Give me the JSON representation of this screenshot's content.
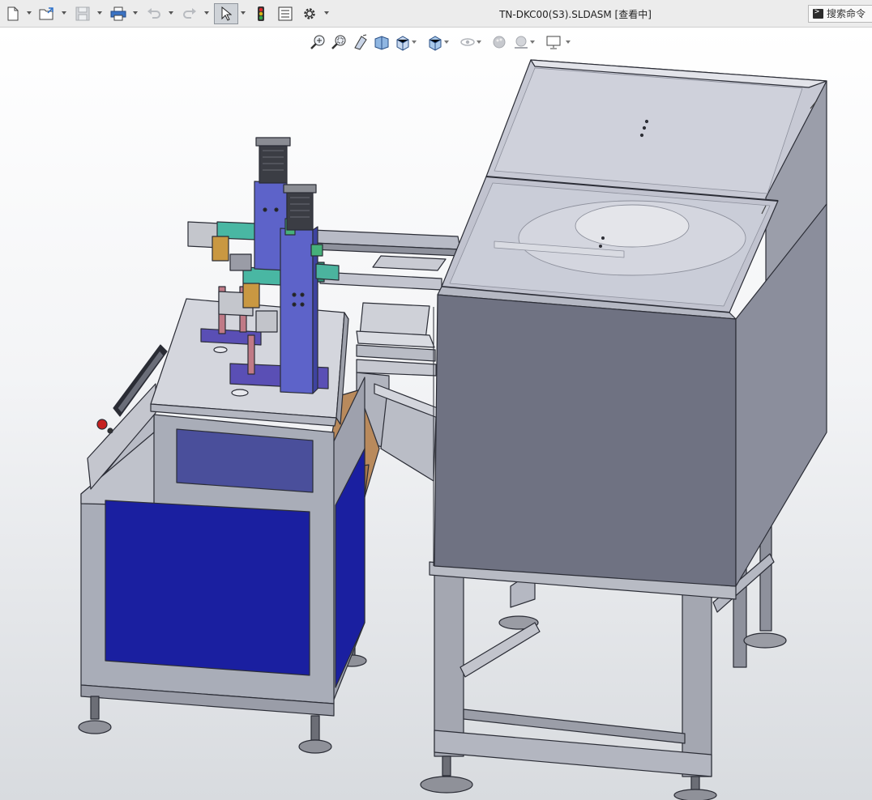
{
  "window": {
    "title": "TN-DKC00(S3).SLDASM [查看中]"
  },
  "toolbar": {
    "items": [
      {
        "icon": "new-document-icon",
        "has_dropdown": true
      },
      {
        "icon": "open-folder-icon",
        "has_dropdown": true
      },
      {
        "icon": "save-icon",
        "has_dropdown": true,
        "disabled": true
      },
      {
        "icon": "print-icon",
        "has_dropdown": true
      },
      {
        "icon": "undo-icon",
        "has_dropdown": true,
        "disabled": true
      },
      {
        "icon": "redo-icon",
        "has_dropdown": true,
        "disabled": true
      },
      {
        "icon": "select-pointer-icon",
        "has_dropdown": true,
        "active": true
      },
      {
        "icon": "traffic-light-icon",
        "has_dropdown": false
      },
      {
        "icon": "file-properties-icon",
        "has_dropdown": false
      },
      {
        "icon": "options-gear-icon",
        "has_dropdown": true
      }
    ]
  },
  "search": {
    "placeholder": "搜索命令"
  },
  "view_toolbar": {
    "items": [
      "zoom-to-fit-icon",
      "zoom-to-area-icon",
      "previous-view-icon",
      "section-view-icon",
      "view-orientation-icon",
      "display-style-icon",
      "hide-show-items-icon",
      "edit-appearance-icon",
      "apply-scene-icon",
      "view-settings-icon"
    ]
  },
  "colors": {
    "accent_blue": "#1a1fa0",
    "frame_gray": "#a9adb8",
    "panel_gray": "#6f7282",
    "hood_gray": "#c5c7d3"
  }
}
